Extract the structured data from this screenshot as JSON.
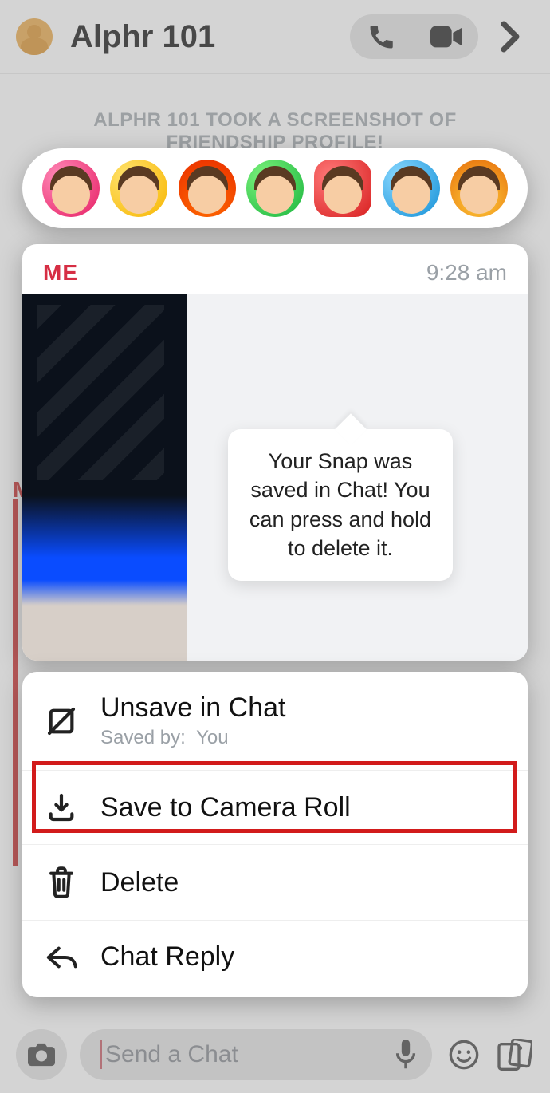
{
  "header": {
    "title": "Alphr 101"
  },
  "system_messages": [
    "ALPHR 101 TOOK A SCREENSHOT OF FRIENDSHIP PROFILE!",
    "ALPHR 101 TOOK A SCREENSHOT OF FRIENDSHIP PROFILE!",
    "ALPHR 101 TOOK A SCREENSHOT OF FRIENDSHIP PROFILE!"
  ],
  "reactions": [
    "heart",
    "tears",
    "fire",
    "thumbs-up",
    "thumbs-down",
    "cry",
    "explode"
  ],
  "message": {
    "sender": "ME",
    "time": "9:28 am",
    "tooltip": "Your Snap was saved in Chat! You can press and hold to delete it."
  },
  "saved_marker": "M",
  "actions": {
    "unsave": {
      "label": "Unsave in Chat",
      "saved_by_prefix": "Saved by:",
      "saved_by_value": "You"
    },
    "save_roll": {
      "label": "Save to Camera Roll"
    },
    "delete": {
      "label": "Delete"
    },
    "reply": {
      "label": "Chat Reply"
    }
  },
  "input": {
    "placeholder": "Send a Chat"
  }
}
